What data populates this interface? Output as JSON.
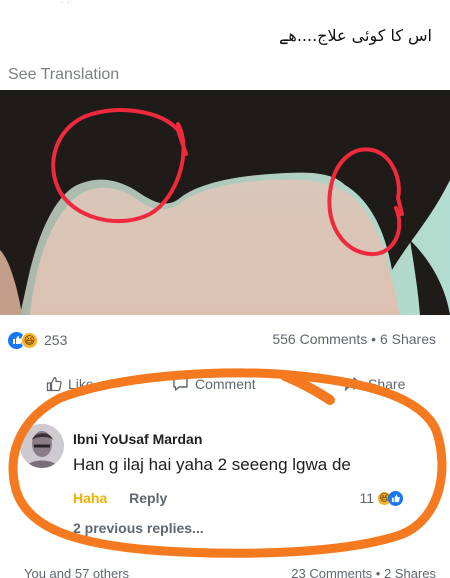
{
  "post": {
    "text": "اس کا کوئی علاج....ھے",
    "see_translation": "See Translation"
  },
  "stats": {
    "reaction_count": "253",
    "comments_shares": "556 Comments • 6 Shares"
  },
  "actions": {
    "like": "Like",
    "comment": "Comment",
    "share": "Share"
  },
  "comment": {
    "author": "Ibni YoUsaf Mardan",
    "text": "Han g ilaj hai yaha 2 seeeng lgwa de",
    "haha_label": "Haha",
    "reply_label": "Reply",
    "reaction_count": "11",
    "previous_replies": "2 previous replies..."
  },
  "bottom": {
    "reactors": "You and 57 others",
    "comments_shares": "23 Comments • 2 Shares"
  },
  "colors": {
    "facebook_blue": "#1877f2",
    "haha_yellow": "#f7b125",
    "annotation_red": "#f02a3c",
    "annotation_orange": "#f57a1f"
  }
}
